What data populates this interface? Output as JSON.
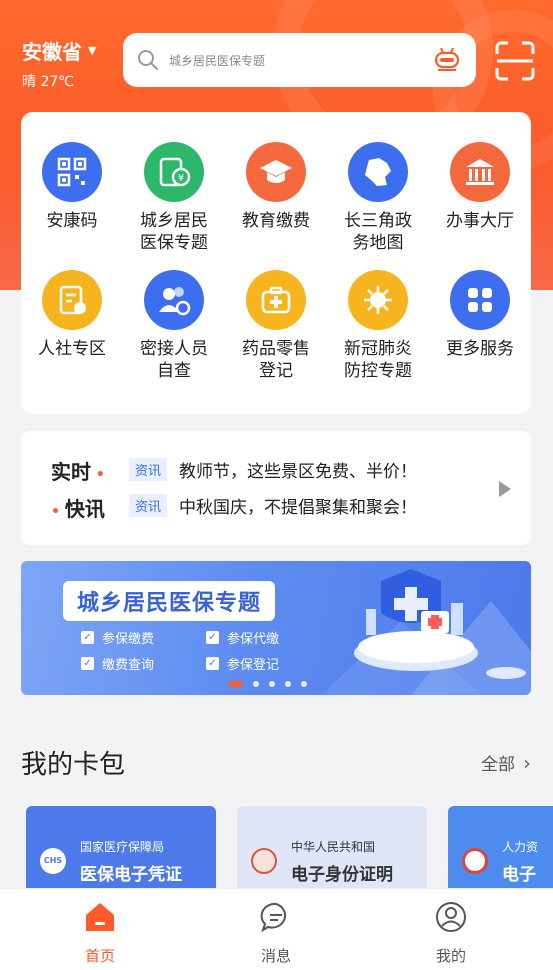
{
  "location": {
    "province": "安徽省",
    "weather": "晴 27℃"
  },
  "search": {
    "placeholder": "城乡居民医保专题"
  },
  "services": [
    {
      "label": "安康码",
      "icon": "qr-code-icon",
      "color": "#3d6ef0"
    },
    {
      "label": "城乡居民医保专题",
      "icon": "medical-insurance-icon",
      "color": "#2cb86a"
    },
    {
      "label": "教育缴费",
      "icon": "graduation-cap-icon",
      "color": "#f4683d"
    },
    {
      "label": "长三角政务地图",
      "icon": "map-icon",
      "color": "#3d6ef0"
    },
    {
      "label": "办事大厅",
      "icon": "government-building-icon",
      "color": "#f4683d"
    },
    {
      "label": "人社专区",
      "icon": "social-security-icon",
      "color": "#f6b51f"
    },
    {
      "label": "密接人员自查",
      "icon": "contact-check-icon",
      "color": "#3d6ef0"
    },
    {
      "label": "药品零售登记",
      "icon": "medicine-kit-icon",
      "color": "#f6b51f"
    },
    {
      "label": "新冠肺炎防控专题",
      "icon": "virus-icon",
      "color": "#f6b51f"
    },
    {
      "label": "更多服务",
      "icon": "more-grid-icon",
      "color": "#3d6ef0"
    }
  ],
  "news": {
    "logo_line1": "实时",
    "logo_line2": "快讯",
    "items": [
      {
        "tag": "资讯",
        "text": "教师节，这些景区免费、半价！"
      },
      {
        "tag": "资讯",
        "text": "中秋国庆，不提倡聚集和聚会！"
      }
    ]
  },
  "banner": {
    "title": "城乡居民医保专题",
    "checks": [
      "参保缴费",
      "参保代缴",
      "缴费查询",
      "参保登记"
    ],
    "slides": 5,
    "active_slide": 0
  },
  "card_pack": {
    "title": "我的卡包",
    "more": "全部",
    "cards": [
      {
        "issuer": "国家医疗保障局",
        "name": "医保电子凭证",
        "badge": "CHS",
        "bg": "#4d79ea",
        "fg": "#ffffff"
      },
      {
        "issuer": "中华人民共和国",
        "name": "电子身份证明",
        "bg": "#dfe6f7",
        "fg": "#333333"
      },
      {
        "issuer": "人力资",
        "name": "电子",
        "bg": "#4d8bee",
        "fg": "#ffffff"
      }
    ]
  },
  "tabs": [
    {
      "label": "首页",
      "icon": "home-icon",
      "active": true
    },
    {
      "label": "消息",
      "icon": "message-icon",
      "active": false
    },
    {
      "label": "我的",
      "icon": "profile-icon",
      "active": false
    }
  ],
  "colors": {
    "brand": "#ff5b2a",
    "accent_blue": "#3d6ef0"
  }
}
